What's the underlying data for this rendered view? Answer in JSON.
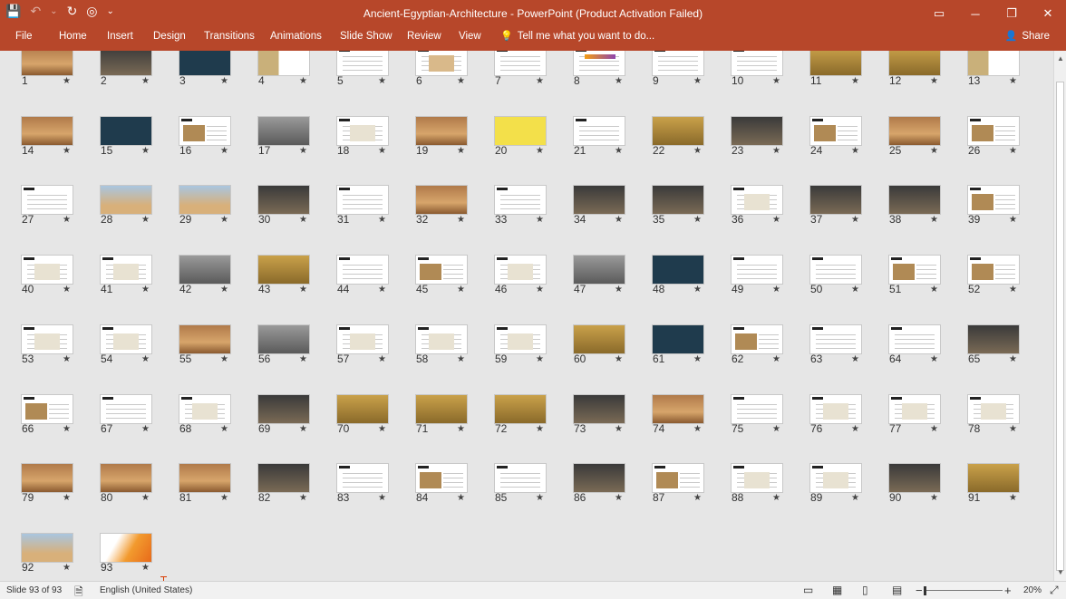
{
  "window": {
    "title": "Ancient-Egyptian-Architecture - PowerPoint (Product Activation Failed)",
    "controls": [
      "▭",
      "─",
      "❐",
      "✕"
    ]
  },
  "qat": {
    "save": "💾",
    "undo": "↶",
    "undo_more": "⌄",
    "redo": "↻",
    "present": "◎",
    "more": "⌄"
  },
  "tabs": [
    "File",
    "Home",
    "Insert",
    "Design",
    "Transitions",
    "Animations",
    "Slide Show",
    "Review",
    "View"
  ],
  "tell_me": {
    "icon": "💡",
    "text": "Tell me what you want to do..."
  },
  "share": {
    "icon": "👤",
    "label": "Share"
  },
  "slides": {
    "numbers": [
      "1",
      "2",
      "3",
      "4",
      "5",
      "6",
      "7",
      "8",
      "9",
      "10",
      "11",
      "12",
      "13",
      "14",
      "15",
      "16",
      "17",
      "18",
      "19",
      "20",
      "21",
      "22",
      "23",
      "24",
      "25",
      "26",
      "27",
      "28",
      "29",
      "30",
      "31",
      "32",
      "33",
      "34",
      "35",
      "36",
      "37",
      "38",
      "39",
      "40",
      "41",
      "42",
      "43",
      "44",
      "45",
      "46",
      "47",
      "48",
      "49",
      "50",
      "51",
      "52",
      "53",
      "54",
      "55",
      "56",
      "57",
      "58",
      "59",
      "60",
      "61",
      "62",
      "63",
      "64",
      "65",
      "66",
      "67",
      "68",
      "69",
      "70",
      "71",
      "72",
      "73",
      "74",
      "75",
      "76",
      "77",
      "78",
      "79",
      "80",
      "81",
      "82",
      "83",
      "84",
      "85",
      "86",
      "87",
      "88",
      "89",
      "90",
      "91",
      "92",
      "93"
    ],
    "star": "★",
    "themes": [
      "photo-warm",
      "photo-dark",
      "dark",
      "map",
      "text",
      "figure",
      "text",
      "band",
      "text",
      "text",
      "photo-gold",
      "photo-gold",
      "map",
      "photo-warm",
      "dark",
      "text-photo",
      "photo-grey",
      "sketch",
      "photo-warm",
      "yellow",
      "text",
      "photo-gold",
      "photo-dark",
      "text-photo",
      "photo-warm",
      "text-photo",
      "text",
      "photo-blue",
      "photo-blue",
      "photo-dark",
      "text",
      "photo-warm",
      "text",
      "photo-dark",
      "photo-dark",
      "sketch",
      "photo-dark",
      "photo-dark",
      "text-photo",
      "sketch",
      "sketch",
      "photo-grey",
      "photo-gold",
      "text",
      "text-photo",
      "sketch",
      "photo-grey",
      "dark",
      "text",
      "text",
      "text-photo",
      "text-photo",
      "sketch",
      "sketch",
      "photo-warm",
      "photo-grey",
      "sketch",
      "sketch",
      "sketch",
      "photo-gold",
      "dark",
      "text-photo",
      "text",
      "text",
      "photo-dark",
      "text-photo",
      "text",
      "sketch",
      "photo-dark",
      "photo-gold",
      "photo-gold",
      "photo-gold",
      "photo-dark",
      "photo-warm",
      "text",
      "sketch",
      "sketch",
      "sketch",
      "photo-warm",
      "photo-warm",
      "photo-warm",
      "photo-dark",
      "text",
      "text-photo",
      "text",
      "photo-dark",
      "text-photo",
      "sketch",
      "sketch",
      "photo-dark",
      "photo-gold",
      "photo-blue",
      "orange"
    ]
  },
  "status": {
    "slide_info": "Slide 93 of 93",
    "notes_icon": "🗎",
    "language": "English (United States)",
    "zoom_minus": "−",
    "zoom_plus": "+",
    "zoom": "20%"
  },
  "colors": {
    "accent": "#b7472a",
    "background": "#e6e6e6",
    "selection": "#d83b01"
  }
}
